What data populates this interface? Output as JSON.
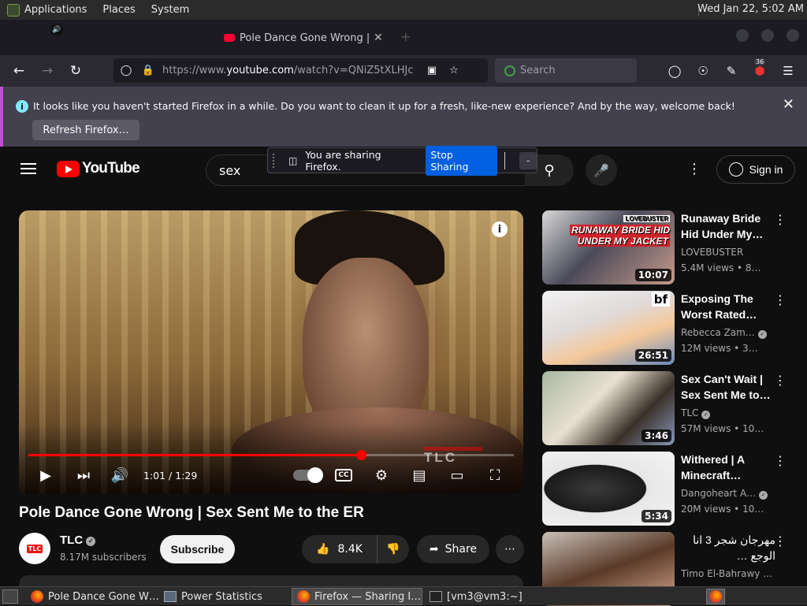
{
  "os_topbar": {
    "menus": [
      "Applications",
      "Places",
      "System"
    ],
    "clock": "Wed Jan 22,  5:02 AM"
  },
  "browser": {
    "tab": {
      "title": "Pole Dance Gone Wrong | Se",
      "close_icon": "close-icon"
    },
    "url": {
      "prefix": "https://www.",
      "host": "youtube.com",
      "path": "/watch?v=QNiZ5tXLHJc"
    },
    "search_placeholder": "Search",
    "extension_badge": "36",
    "notification": {
      "message": "It looks like you haven't started Firefox in a while. Do you want to clean it up for a fresh, like-new experience? And by the way, welcome back!",
      "button": "Refresh Firefox…"
    }
  },
  "sharing_indicator": {
    "message": "You are sharing Firefox.",
    "stop_button": "Stop Sharing",
    "minimize": "–"
  },
  "youtube": {
    "logo_text": "YouTube",
    "search_query": "sex",
    "sign_in": "Sign in",
    "player": {
      "current_time": "1:01",
      "duration": "1:29",
      "time_display": "1:01 / 1:29",
      "progress_fraction": 0.685,
      "buffered_fraction": 0.66,
      "watermark": "TLC",
      "cc_label": "CC"
    },
    "video": {
      "title": "Pole Dance Gone Wrong | Sex Sent Me to the ER",
      "channel": "TLC",
      "avatar_label": "TLC",
      "subscribers": "8.17M subscribers",
      "subscribe": "Subscribe",
      "likes": "8.4K",
      "share": "Share"
    },
    "related": [
      {
        "title": "Runaway Bride Hid Under My…",
        "channel": "LOVEBUSTER",
        "verified": false,
        "views": "5.4M views • 8…",
        "duration": "10:07",
        "thumb_text": "RUNAWAY BRIDE HID UNDER MY JACKET",
        "thumb_brand": "LOVEBUSTER"
      },
      {
        "title": "Exposing The Worst Rated…",
        "channel": "Rebecca Zam…",
        "verified": true,
        "views": "12M views • 3…",
        "duration": "26:51",
        "thumb_text": "bf"
      },
      {
        "title": "Sex Can't Wait | Sex Sent Me to…",
        "channel": "TLC",
        "verified": true,
        "views": "57M views • 10…",
        "duration": "3:46"
      },
      {
        "title": "Withered | A Minecraft…",
        "channel": "Dangoheart A…",
        "verified": true,
        "views": "20M views • 10…",
        "duration": "5:34"
      },
      {
        "title": "مهرجان شجر 3 انا الوجع …",
        "channel": "Timo El-Bahrawy …",
        "verified": false,
        "views": "",
        "duration": ""
      }
    ]
  },
  "taskbar": {
    "items": [
      {
        "label": "Pole Dance Gone W…",
        "icon": "firefox-icon"
      },
      {
        "label": "Power Statistics",
        "icon": "power-statistics-icon"
      },
      {
        "label": "Firefox — Sharing I…",
        "icon": "firefox-icon"
      },
      {
        "label": "[vm3@vm3:~]",
        "icon": "terminal-icon"
      }
    ]
  }
}
